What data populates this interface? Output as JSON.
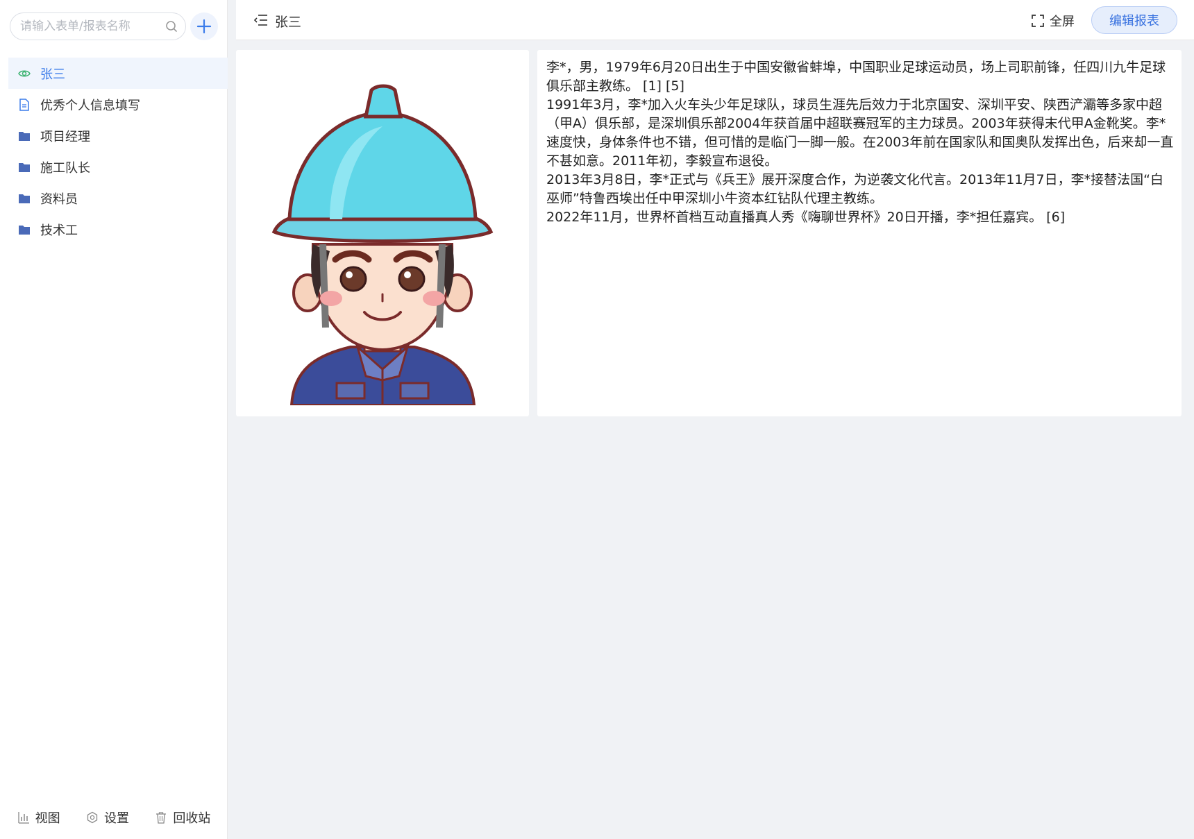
{
  "sidebar": {
    "search": {
      "placeholder": "请输入表单/报表名称",
      "value": ""
    },
    "items": [
      {
        "label": "张三",
        "icon": "eye-icon",
        "active": true
      },
      {
        "label": "优秀个人信息填写",
        "icon": "document-icon",
        "active": false
      },
      {
        "label": "项目经理",
        "icon": "folder-icon",
        "active": false
      },
      {
        "label": "施工队长",
        "icon": "folder-icon",
        "active": false
      },
      {
        "label": "资料员",
        "icon": "folder-icon",
        "active": false
      },
      {
        "label": "技术工",
        "icon": "folder-icon",
        "active": false
      }
    ],
    "bottom": {
      "view": "视图",
      "settings": "设置",
      "trash": "回收站"
    }
  },
  "header": {
    "title": "张三",
    "fullscreen_label": "全屏",
    "edit_label": "编辑报表"
  },
  "content": {
    "paragraphs": [
      "李*，男，1979年6月20日出生于中国安徽省蚌埠，中国职业足球运动员，场上司职前锋，任四川九牛足球俱乐部主教练。 [1] [5]",
      "1991年3月，李*加入火车头少年足球队，球员生涯先后效力于北京国安、深圳平安、陕西浐灞等多家中超（甲A）俱乐部，是深圳俱乐部2004年获首届中超联赛冠军的主力球员。2003年获得末代甲A金靴奖。李*速度快，身体条件也不错，但可惜的是临门一脚一般。在2003年前在国家队和国奥队发挥出色，后来却一直不甚如意。2011年初，李毅宣布退役。",
      "2013年3月8日，李*正式与《兵王》展开深度合作，为逆袭文化代言。2013年11月7日，李*接替法国“白巫师”特鲁西埃出任中甲深圳小牛资本红钻队代理主教练。",
      "2022年11月，世界杯首档互动直播真人秀《嗨聊世界杯》20日开播，李*担任嘉宾。 [6]"
    ]
  },
  "colors": {
    "accent": "#3a7bea",
    "active_bg": "#f0f5fd",
    "page_bg": "#f0f2f5",
    "helmet": "#5fd6e8",
    "uniform": "#3b4c9a"
  }
}
